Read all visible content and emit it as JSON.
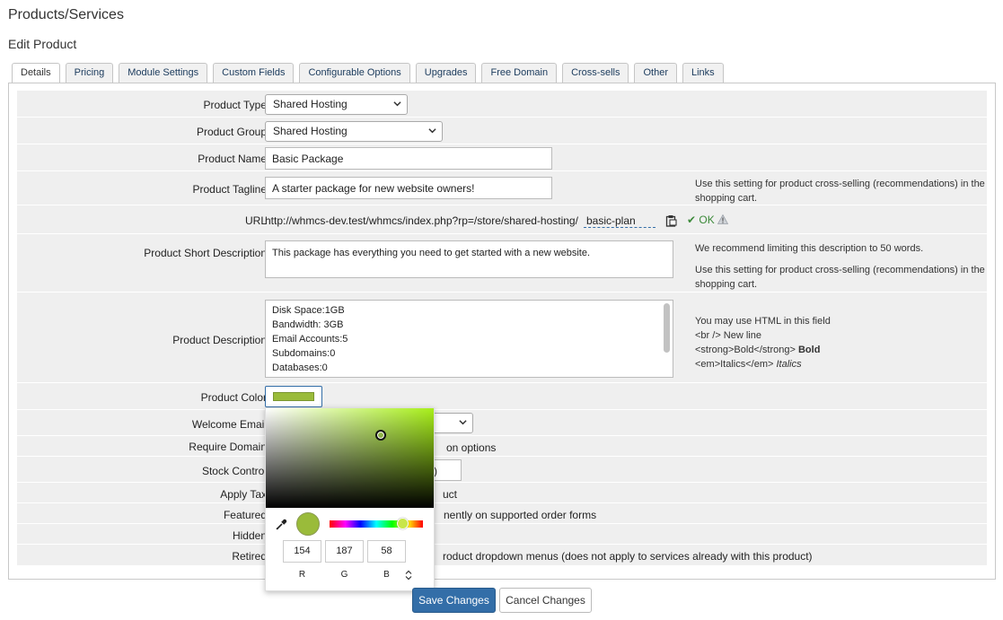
{
  "header": {
    "title": "Products/Services",
    "subtitle": "Edit Product"
  },
  "tabs": [
    {
      "label": "Details",
      "active": true
    },
    {
      "label": "Pricing"
    },
    {
      "label": "Module Settings"
    },
    {
      "label": "Custom Fields"
    },
    {
      "label": "Configurable Options"
    },
    {
      "label": "Upgrades"
    },
    {
      "label": "Free Domain"
    },
    {
      "label": "Cross-sells"
    },
    {
      "label": "Other"
    },
    {
      "label": "Links"
    }
  ],
  "form": {
    "product_type": {
      "label": "Product Type",
      "value": "Shared Hosting"
    },
    "product_group": {
      "label": "Product Group",
      "value": "Shared Hosting"
    },
    "product_name": {
      "label": "Product Name",
      "value": "Basic Package"
    },
    "product_tagline": {
      "label": "Product Tagline",
      "value": "A starter package for new website owners!",
      "help": "Use this setting for product cross-selling (recommendations) in the shopping cart."
    },
    "url": {
      "label": "URL",
      "prefix": "http://whmcs-dev.test/whmcs/index.php?rp=/store/shared-hosting/",
      "slug": "basic-plan",
      "status": "OK"
    },
    "short_description": {
      "label": "Product Short Description",
      "value": "This package has everything you need to get started with a new website.",
      "help1": "We recommend limiting this description to 50 words.",
      "help2": "Use this setting for product cross-selling (recommendations) in the shopping cart."
    },
    "description": {
      "label": "Product Description",
      "lines": [
        "Disk Space:1GB",
        "Bandwidth: 3GB",
        "Email Accounts:5",
        "Subdomains:0",
        "Databases:0"
      ],
      "help_title": "You may use HTML in this field",
      "help_br": "<br /> New line",
      "help_strong": "<strong>Bold</strong>",
      "help_strong_demo": "Bold",
      "help_em": "<em>Italics</em>",
      "help_em_demo": "Italics"
    },
    "product_color": {
      "label": "Product Color",
      "hex": "#9abb3a"
    },
    "welcome_email": {
      "label": "Welcome Email"
    },
    "require_domain": {
      "label": "Require Domain",
      "text_partial": "on options"
    },
    "stock_control": {
      "label": "Stock Control",
      "value_partial": ")"
    },
    "apply_tax": {
      "label": "Apply Tax",
      "text_partial": "uct"
    },
    "featured": {
      "label": "Featured",
      "text_partial": "nently on supported order forms"
    },
    "hidden": {
      "label": "Hidden"
    },
    "retired": {
      "label": "Retired",
      "text_partial": "roduct dropdown menus (does not apply to services already with this product)"
    }
  },
  "color_picker": {
    "r": "154",
    "g": "187",
    "b": "58",
    "r_label": "R",
    "g_label": "G",
    "b_label": "B",
    "hue_color": "#a8ef1a",
    "preview_color": "#9abb3a"
  },
  "actions": {
    "save": "Save Changes",
    "cancel": "Cancel Changes"
  },
  "colors": {
    "primary": "#336ea8",
    "ok_green": "#3c8a3a",
    "row_bg": "#efefef"
  }
}
